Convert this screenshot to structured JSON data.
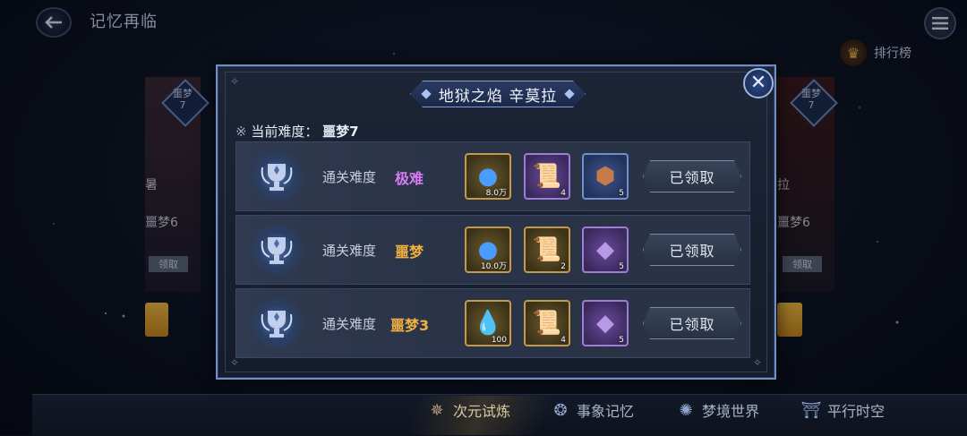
{
  "header": {
    "title": "记忆再临",
    "rank_label": "排行榜"
  },
  "background_cards": {
    "left": {
      "diff_top": "噩梦",
      "diff_num": "7",
      "name_fragment": "暑",
      "diff_text": "噩梦6",
      "claim_label": "领取"
    },
    "right": {
      "diff_top": "噩梦",
      "diff_num": "7",
      "name_fragment": "拉",
      "diff_text": "噩梦6",
      "claim_label": "领取"
    }
  },
  "modal": {
    "title": "地狱之焰 辛莫拉",
    "current_mark": "※",
    "current_label": "当前难度：",
    "current_value": "噩梦7",
    "rows": [
      {
        "label": "通关难度",
        "difficulty": "极难",
        "difficulty_color": "#d77cf0",
        "rewards": [
          {
            "icon": "blue-flame-orb-icon",
            "count": "8.0万",
            "frame": "gold"
          },
          {
            "icon": "scroll-blue-icon",
            "count": "4",
            "frame": "purple"
          },
          {
            "icon": "copper-ore-icon",
            "count": "5",
            "frame": "blue"
          }
        ],
        "button": "已领取"
      },
      {
        "label": "通关难度",
        "difficulty": "噩梦",
        "difficulty_color": "#f1b13e",
        "rewards": [
          {
            "icon": "blue-flame-orb-icon",
            "count": "10.0万",
            "frame": "gold"
          },
          {
            "icon": "scroll-gold-icon",
            "count": "2",
            "frame": "gold"
          },
          {
            "icon": "purple-crystal-icon",
            "count": "5",
            "frame": "purple"
          }
        ],
        "button": "已领取"
      },
      {
        "label": "通关难度",
        "difficulty": "噩梦3",
        "difficulty_color": "#f1b13e",
        "rewards": [
          {
            "icon": "rainbow-gem-icon",
            "count": "100",
            "frame": "gold"
          },
          {
            "icon": "scroll-gold-icon",
            "count": "4",
            "frame": "gold"
          },
          {
            "icon": "purple-crystal-icon",
            "count": "5",
            "frame": "purple"
          }
        ],
        "button": "已领取"
      }
    ]
  },
  "bottom_nav": [
    {
      "label": "次元试炼",
      "icon": "star-burst-icon",
      "active": true
    },
    {
      "label": "事象记忆",
      "icon": "swirl-icon",
      "active": false
    },
    {
      "label": "梦境世界",
      "icon": "dream-orb-icon",
      "active": false
    },
    {
      "label": "平行时空",
      "icon": "gate-icon",
      "active": false
    }
  ]
}
